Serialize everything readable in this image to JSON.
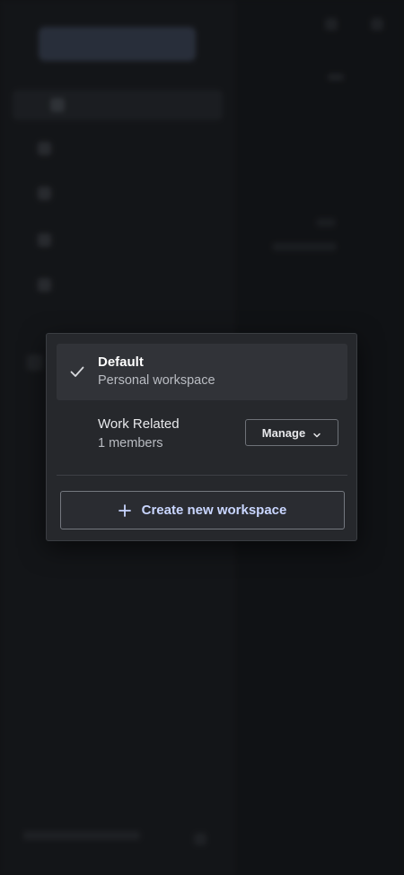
{
  "workspace_menu": {
    "selected": {
      "name": "Default",
      "subtitle": "Personal workspace",
      "icon": "check-icon"
    },
    "others": [
      {
        "name": "Work Related",
        "subtitle": "1 members",
        "action_label": "Manage",
        "action_icon": "chevron-down-icon"
      }
    ],
    "create_label": "Create new workspace",
    "create_icon": "plus-icon"
  },
  "colors": {
    "popover_bg": "#26282c",
    "selected_row_bg": "#313338",
    "create_label": "#c9d6ff",
    "background": "#151619"
  }
}
